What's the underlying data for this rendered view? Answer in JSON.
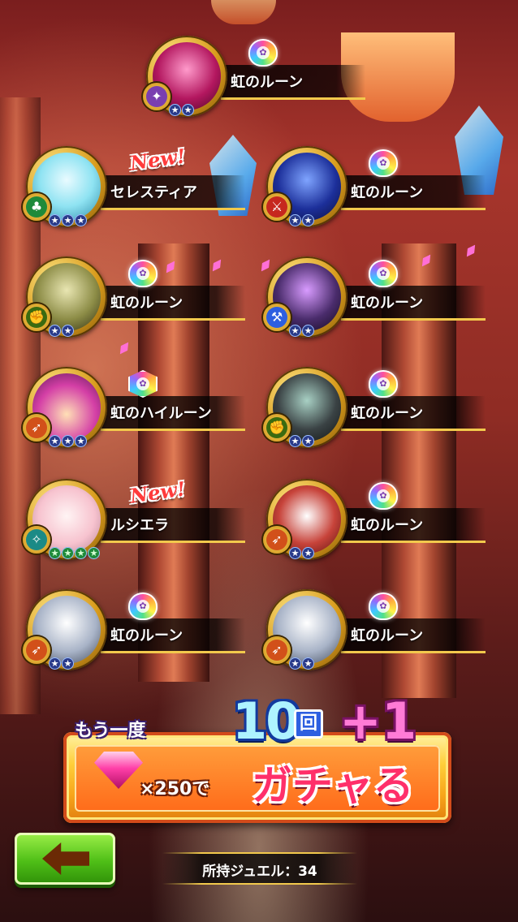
{
  "rewards": [
    {
      "id": "r1",
      "name": "虹のルーン",
      "badge": "",
      "rune": "round",
      "stars": 2,
      "star_color": "blue",
      "class_icon": "staff-icon",
      "art": "pink-knight"
    },
    {
      "id": "r2",
      "name": "セレスティア",
      "badge": "New!",
      "rune": "",
      "stars": 3,
      "star_color": "blue",
      "class_icon": "leaf-icon",
      "art": "blue-hair-mage"
    },
    {
      "id": "r3",
      "name": "虹のルーン",
      "badge": "",
      "rune": "round",
      "stars": 2,
      "star_color": "blue",
      "class_icon": "sword-icon",
      "art": "blue-knight"
    },
    {
      "id": "r4",
      "name": "虹のルーン",
      "badge": "",
      "rune": "round",
      "stars": 2,
      "star_color": "blue",
      "class_icon": "fist-icon",
      "art": "gold-knight"
    },
    {
      "id": "r5",
      "name": "虹のルーン",
      "badge": "",
      "rune": "round",
      "stars": 2,
      "star_color": "blue",
      "class_icon": "axe-icon",
      "art": "purple-knight"
    },
    {
      "id": "r6",
      "name": "虹のハイルーン",
      "badge": "",
      "rune": "hex",
      "stars": 3,
      "star_color": "blue",
      "class_icon": "bow-icon",
      "art": "hat-girl"
    },
    {
      "id": "r7",
      "name": "虹のルーン",
      "badge": "",
      "rune": "round",
      "stars": 2,
      "star_color": "blue",
      "class_icon": "fist-icon",
      "art": "black-cat"
    },
    {
      "id": "r8",
      "name": "ルシエラ",
      "badge": "New!",
      "rune": "",
      "stars": 4,
      "star_color": "green",
      "class_icon": "wing-icon",
      "art": "pink-hair-girl"
    },
    {
      "id": "r9",
      "name": "虹のルーン",
      "badge": "",
      "rune": "round",
      "stars": 2,
      "star_color": "blue",
      "class_icon": "bow-icon",
      "art": "owl"
    },
    {
      "id": "r10",
      "name": "虹のルーン",
      "badge": "",
      "rune": "round",
      "stars": 2,
      "star_color": "blue",
      "class_icon": "bow-icon",
      "art": "white-knight"
    },
    {
      "id": "r11",
      "name": "虹のルーン",
      "badge": "",
      "rune": "round",
      "stars": 2,
      "star_color": "blue",
      "class_icon": "bow-icon",
      "art": "white-knight"
    }
  ],
  "gacha_button": {
    "again_label": "もう一度",
    "count": "10",
    "times_label": "回",
    "bonus": "+1",
    "cost_label": "×250で",
    "action_label": "ガチャる"
  },
  "back_button": {
    "icon": "left-arrow-icon"
  },
  "jewels": {
    "label": "所持ジュエル：34"
  },
  "colors": {
    "accent_gold": "#f2c94c",
    "gacha_orange": "#ff9d3b",
    "back_green": "#4fbf17",
    "star_blue": "#2a3b8a",
    "star_green": "#1e8a3a"
  }
}
